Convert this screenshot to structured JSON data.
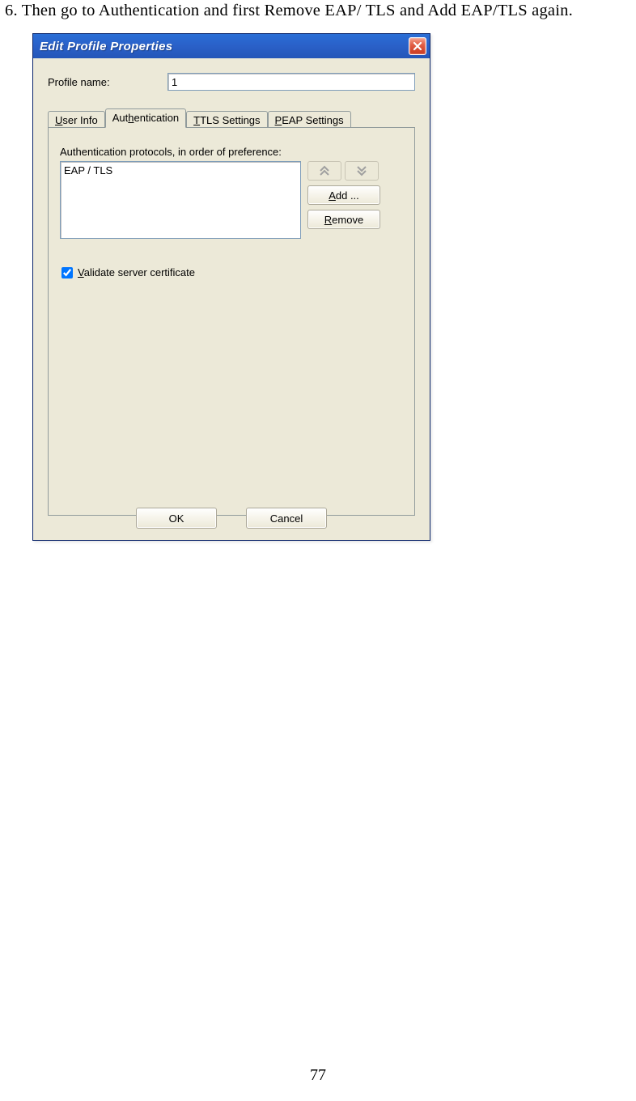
{
  "instruction_text": "6. Then go to Authentication and first Remove EAP/ TLS and Add EAP/TLS again.",
  "page_number": "77",
  "dialog": {
    "title": "Edit Profile Properties",
    "profile_name_label": "Profile name:",
    "profile_name_value": "1",
    "tabs": {
      "user_info_pre": "U",
      "user_info_post": "ser Info",
      "auth_pre": "Aut",
      "auth_ul": "h",
      "auth_post": "entication",
      "ttls_ul": "T",
      "ttls_post": "TLS Settings",
      "peap_ul": "P",
      "peap_post": "EAP Settings"
    },
    "auth": {
      "label_pre": "Authentication protocols, in ",
      "label_ul": "o",
      "label_post": "rder of preference:",
      "list_item_0": "EAP / TLS",
      "add_ul": "A",
      "add_post": "dd ...",
      "remove_ul": "R",
      "remove_post": "emove",
      "validate_ul": "V",
      "validate_post": "alidate server certificate",
      "validate_checked": true
    },
    "ok_label": "OK",
    "cancel_label": "Cancel"
  }
}
